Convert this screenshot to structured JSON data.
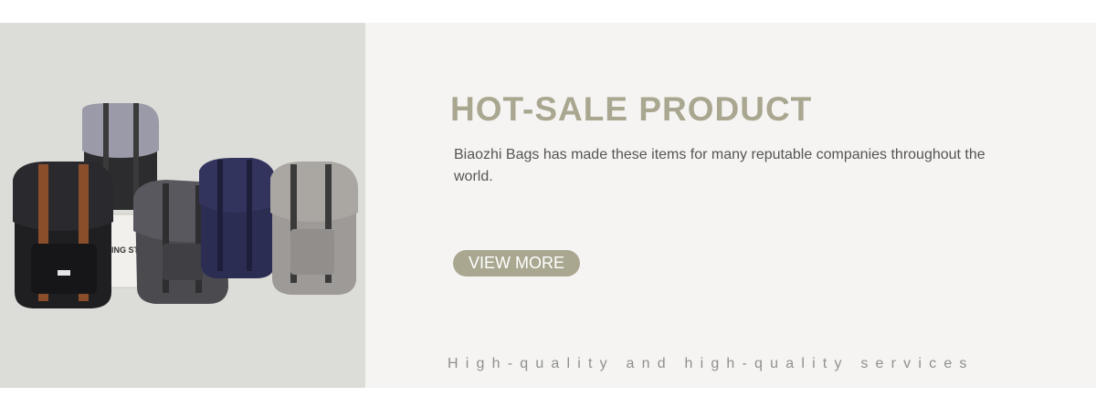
{
  "hero": {
    "image_alt": "backpacks-product-photo",
    "box_text": "ING STO",
    "title": "HOT-SALE PRODUCT",
    "description": "Biaozhi Bags has made these items for many reputable companies throughout the world.",
    "cta_label": "VIEW MORE",
    "tagline": "High-quality and high-quality services"
  },
  "colors": {
    "accent": "#a9a790",
    "photo_bg": "#dcdcd8",
    "panel_bg": "#f5f4f2"
  }
}
